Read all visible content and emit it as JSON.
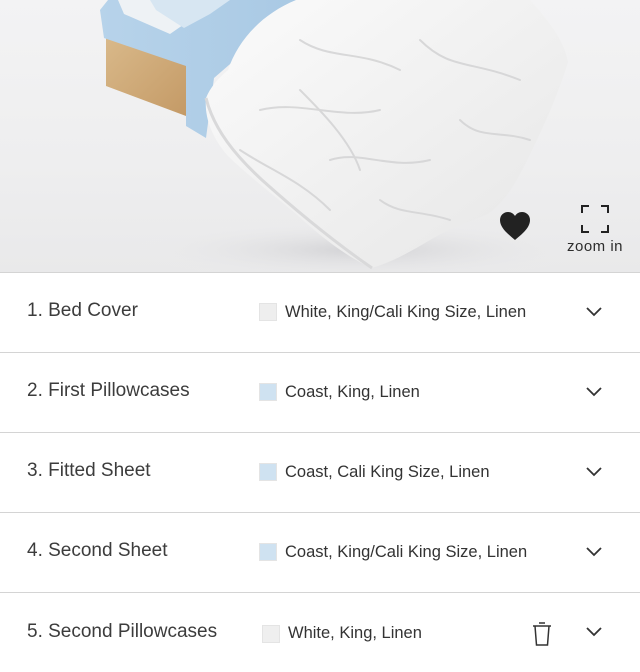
{
  "hero": {
    "favorite_icon": "heart-icon",
    "zoom_icon": "expand-corners-icon",
    "zoom_label": "zoom in"
  },
  "items": [
    {
      "title": "1. Bed Cover",
      "swatch_color": "#eeeeee",
      "description": "White, King/Cali King Size, Linen"
    },
    {
      "title": "2. First Pillowcases",
      "swatch_color": "#cfe2f1",
      "description": "Coast, King, Linen"
    },
    {
      "title": "3. Fitted Sheet",
      "swatch_color": "#cfe2f1",
      "description": "Coast, Cali King Size, Linen"
    },
    {
      "title": "4. Second Sheet",
      "swatch_color": "#cfe2f1",
      "description": "Coast, King/Cali King Size, Linen"
    },
    {
      "title": "5. Second Pillowcases",
      "swatch_color": "#efefef",
      "description": "White, King, Linen",
      "has_remove_icon": true
    }
  ],
  "colors": {
    "divider": "#d4d4d4",
    "icon": "#222222",
    "coast": "#cfe2f1",
    "white": "#eeeeee"
  }
}
